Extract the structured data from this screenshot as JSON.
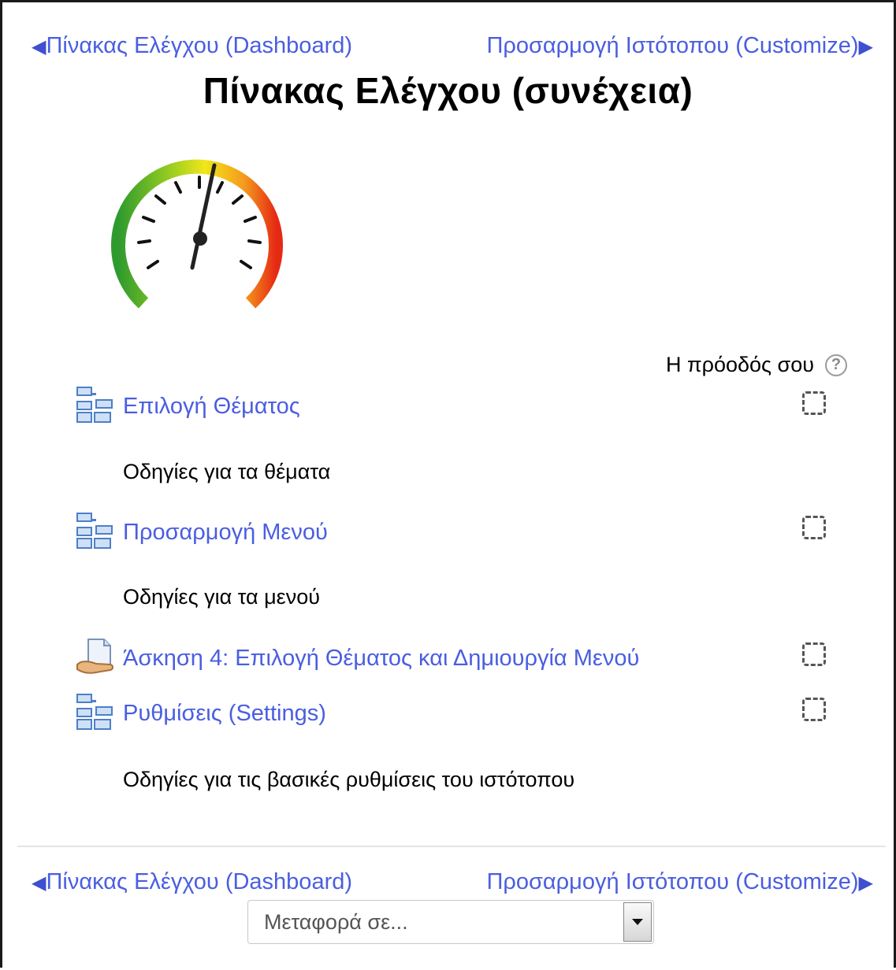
{
  "nav_top": {
    "prev_label": "Πίνακας Ελέγχου (Dashboard)",
    "next_label": "Προσαρμογή Ιστότοπου (Customize)"
  },
  "page_title": "Πίνακας Ελέγχου (συνέχεια)",
  "progress_header": "Η πρόοδός σου",
  "activities": [
    {
      "type": "page",
      "name": "Επιλογή Θέματος",
      "description": "Οδηγίες για τα θέματα",
      "completed": false
    },
    {
      "type": "page",
      "name": "Προσαρμογή Μενού",
      "description": "Οδηγίες για τα μενού",
      "completed": false
    },
    {
      "type": "assignment",
      "name": "Άσκηση 4: Επιλογή Θέματος και Δημιουργία Μενού",
      "description": "",
      "completed": false
    },
    {
      "type": "page",
      "name": "Ρυθμίσεις (Settings)",
      "description": "Οδηγίες για τις βασικές ρυθμίσεις του ιστότοπου",
      "completed": false
    }
  ],
  "nav_bottom": {
    "prev_label": "Πίνακας Ελέγχου (Dashboard)",
    "next_label": "Προσαρμογή Ιστότοπου (Customize)"
  },
  "jump_to": {
    "placeholder": "Μεταφορά σε..."
  },
  "colors": {
    "link": "#4a5ee0",
    "text": "#000000",
    "border": "#1a1a1a"
  },
  "icons": {
    "prev": "triangle-left-icon",
    "next": "triangle-right-icon",
    "help": "question-circle-icon",
    "page": "page-structure-icon",
    "assignment": "assignment-hand-icon",
    "gauge": "speedometer-image"
  }
}
